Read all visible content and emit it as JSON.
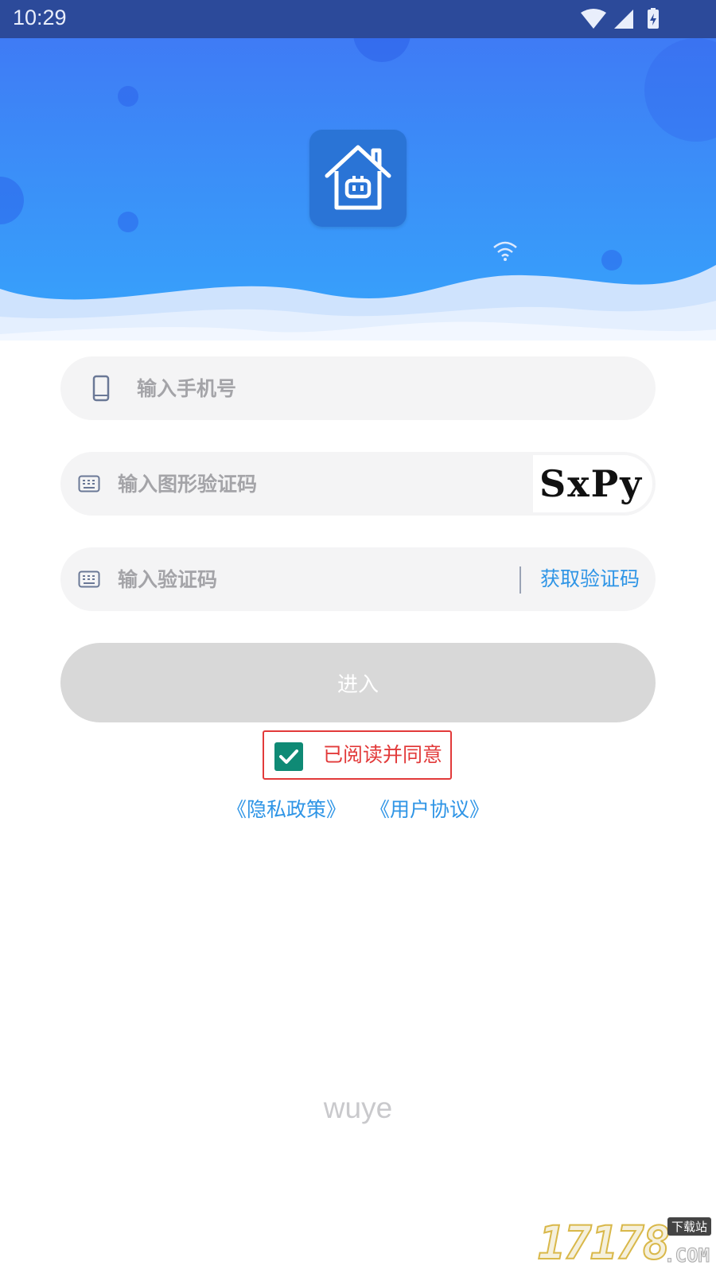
{
  "status_bar": {
    "time": "10:29",
    "icons": [
      "wifi-icon",
      "signal-icon",
      "battery-charging-icon"
    ]
  },
  "header": {
    "logo_icon": "house-robot-icon",
    "accent_color": "#3b8ff8"
  },
  "form": {
    "phone": {
      "placeholder": "输入手机号",
      "icon": "phone-icon",
      "value": ""
    },
    "captcha": {
      "placeholder": "输入图形验证码",
      "icon": "keyboard-icon",
      "value": "",
      "captcha_text": "SxPy"
    },
    "sms_code": {
      "placeholder": "输入验证码",
      "icon": "keyboard-icon",
      "value": "",
      "get_code_label": "获取验证码"
    },
    "submit_label": "进入",
    "agree": {
      "checked": true,
      "label": "已阅读并同意"
    },
    "privacy_link": "《隐私政策》",
    "terms_link": "《用户协议》"
  },
  "footer": {
    "brand": "wuye"
  },
  "watermark": {
    "digits": "17178",
    "tag": "下载站",
    "suffix": ".COM"
  },
  "colors": {
    "link": "#2f95e6",
    "agree_red": "#e23a3a",
    "checkbox_green": "#0f8a75",
    "button_disabled": "#d8d8d8"
  }
}
